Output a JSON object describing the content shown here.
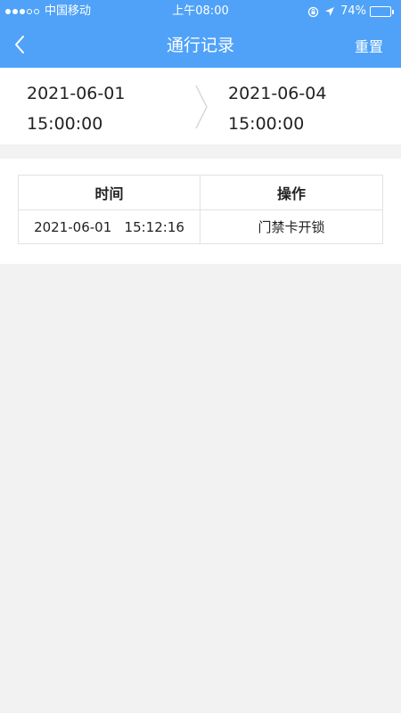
{
  "status_bar": {
    "carrier": "中国移动",
    "time": "上午08:00",
    "battery_text": "74%",
    "battery_level": 0.74
  },
  "nav": {
    "title": "通行记录",
    "reset_label": "重置",
    "back_icon": "chevron-left-icon"
  },
  "date_range": {
    "start_date": "2021-06-01",
    "start_time": "15:00:00",
    "end_date": "2021-06-04",
    "end_time": "15:00:00"
  },
  "table": {
    "headers": [
      "时间",
      "操作"
    ],
    "rows": [
      {
        "time": "2021-06-01   15:12:16",
        "action": "门禁卡开锁"
      }
    ]
  },
  "colors": {
    "header_bg": "#4fa2f8",
    "page_bg": "#f2f2f2"
  }
}
